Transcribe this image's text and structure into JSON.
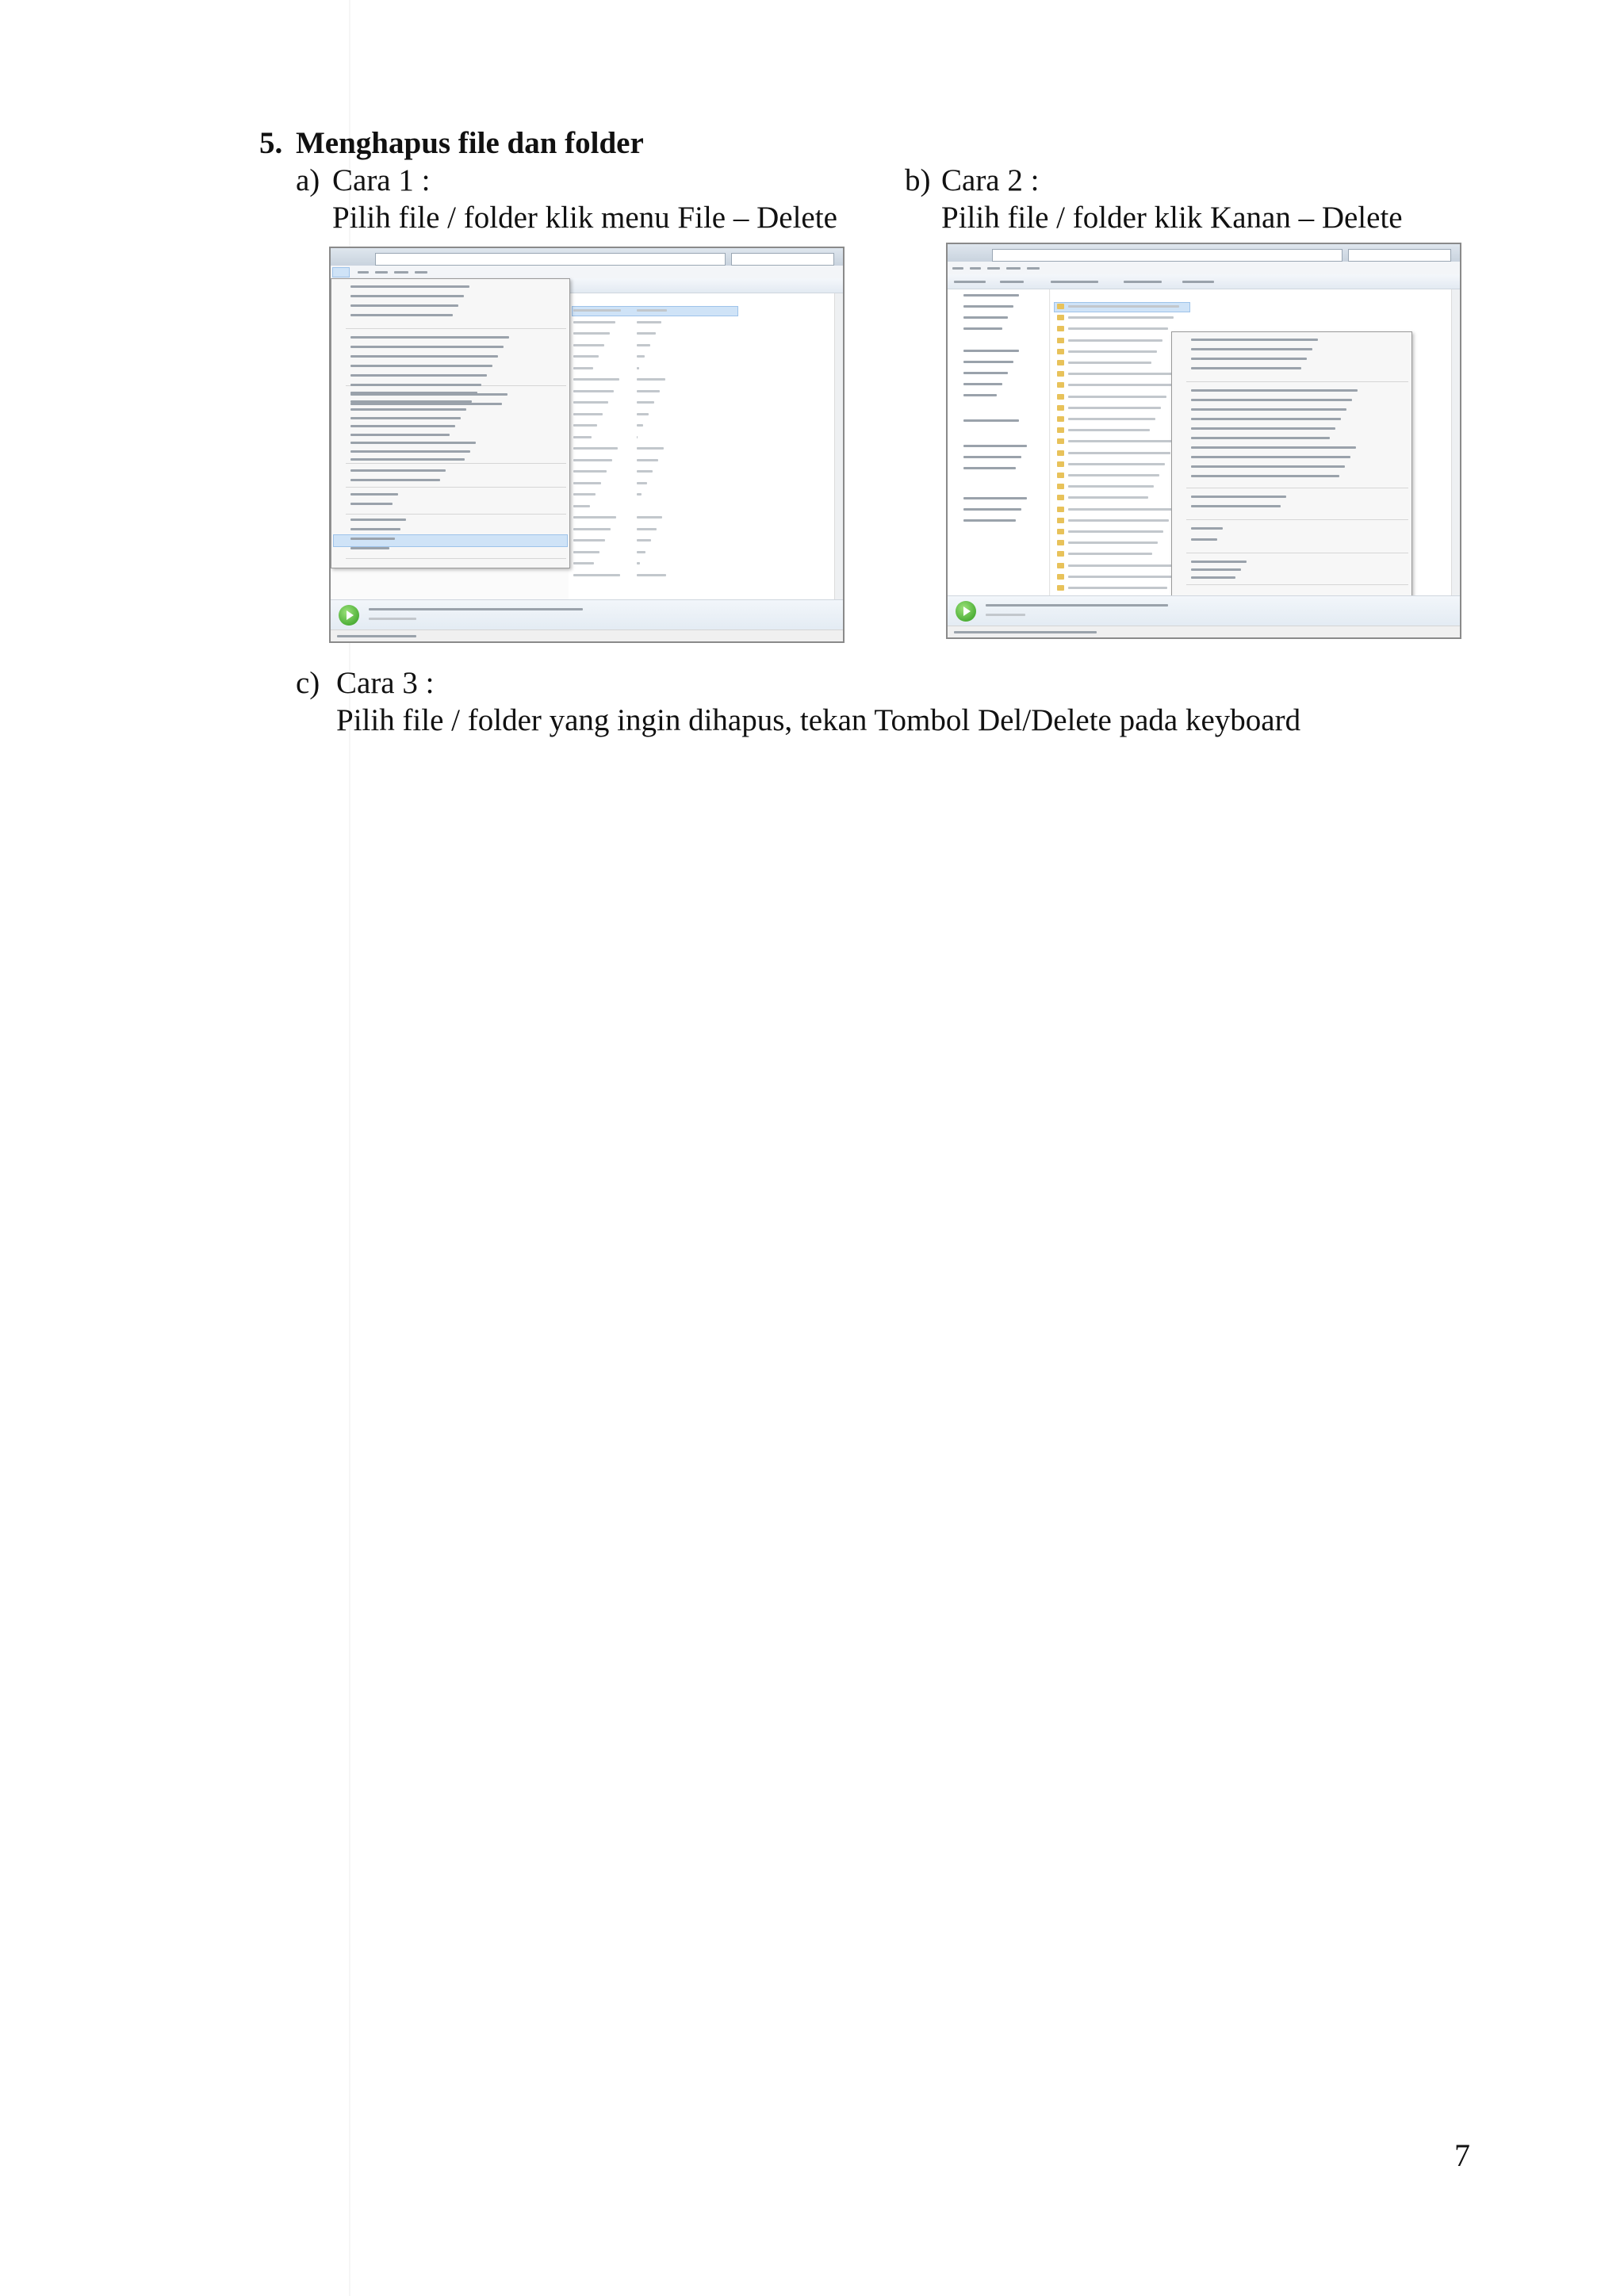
{
  "heading": {
    "number": "5.",
    "title": "Menghapus file dan folder"
  },
  "method_a": {
    "marker": "a)",
    "title": "Cara 1 :",
    "desc": "Pilih file / folder klik menu File – Delete"
  },
  "method_b": {
    "marker": "b)",
    "title": "Cara 2 :",
    "desc": "Pilih file / folder klik Kanan – Delete"
  },
  "method_c": {
    "marker": "c)",
    "title": "Cara 3 :",
    "desc": "Pilih file / folder yang ingin dihapus, tekan Tombol Del/Delete pada keyboard"
  },
  "page_number": "7"
}
